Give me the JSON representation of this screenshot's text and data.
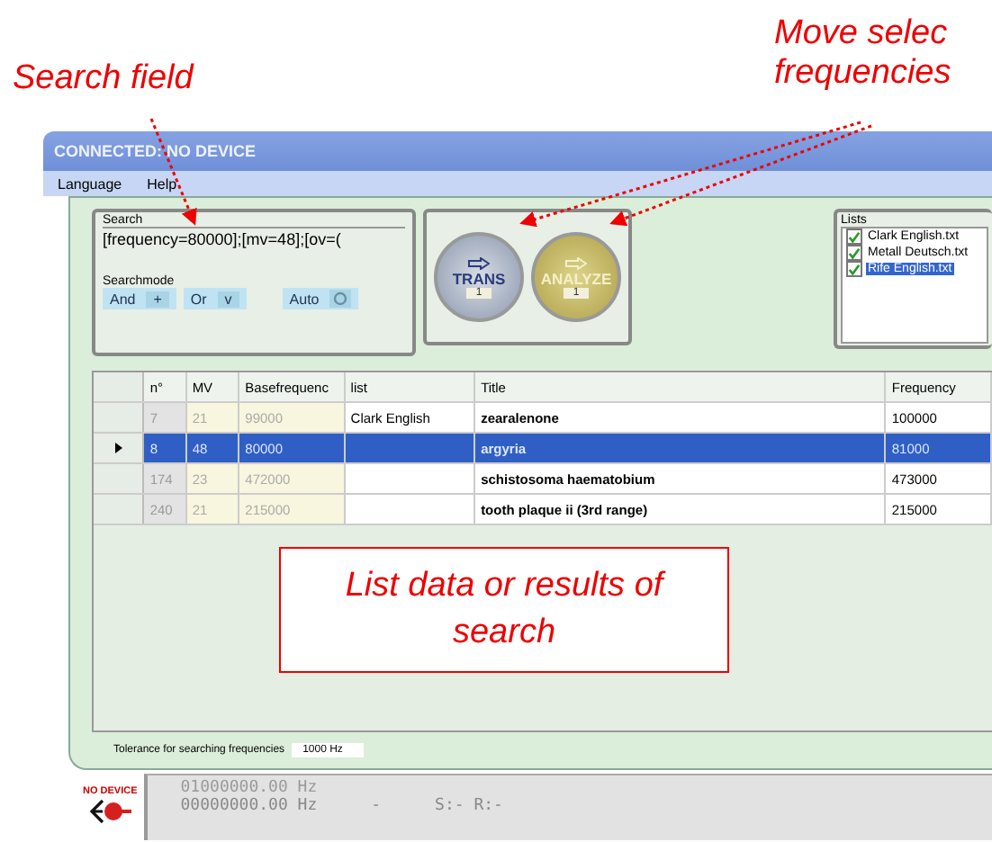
{
  "annotations": {
    "search_note": "Search field",
    "move_note": [
      "Move selec",
      "frequencies"
    ],
    "list_note": "List data or results of search"
  },
  "window": {
    "title": "CONNECTED: NO DEVICE"
  },
  "menu": [
    "Language",
    "Help"
  ],
  "search": {
    "label": "Search",
    "value": "[frequency=80000];[mv=48];[ov=(",
    "mode_label": "Searchmode",
    "modes": [
      {
        "kind": "text",
        "label": "And",
        "symbol": "+"
      },
      {
        "kind": "text",
        "label": "Or",
        "symbol": "v"
      },
      {
        "kind": "icon",
        "label": "Auto"
      }
    ]
  },
  "actions": [
    {
      "kind": "trans",
      "label": "TRANS",
      "count": "1"
    },
    {
      "kind": "analyze",
      "label": "ANALYZE",
      "count": "1"
    }
  ],
  "lists": {
    "title": "Lists",
    "items": [
      {
        "label": "Clark English.txt",
        "checked": true,
        "selected": false
      },
      {
        "label": "Metall Deutsch.txt",
        "checked": true,
        "selected": false
      },
      {
        "label": "Rife English.txt",
        "checked": true,
        "selected": true
      }
    ]
  },
  "table": {
    "columns": [
      "n°",
      "MV",
      "Basefrequenc",
      "list",
      "Title",
      "Frequency"
    ],
    "rows": [
      {
        "cells": [
          "7",
          "21",
          "99000",
          "Clark English",
          "zearalenone",
          "100000"
        ],
        "selected": false
      },
      {
        "cells": [
          "8",
          "48",
          "80000",
          "",
          "argyria",
          "81000"
        ],
        "selected": true
      },
      {
        "cells": [
          "174",
          "23",
          "472000",
          "",
          "schistosoma haematobium",
          "473000"
        ],
        "selected": false
      },
      {
        "cells": [
          "240",
          "21",
          "215000",
          "",
          "tooth plaque ii (3rd range)",
          "215000"
        ],
        "selected": false
      }
    ]
  },
  "tolerance": {
    "label": "Tolerance for searching frequencies",
    "value": "1000 Hz"
  },
  "status": {
    "device_label": "NO DEVICE",
    "line_1": "01000000.00 Hz",
    "line_2": "00000000.00 Hz",
    "dash": "-",
    "sr": "S:- R:-"
  }
}
